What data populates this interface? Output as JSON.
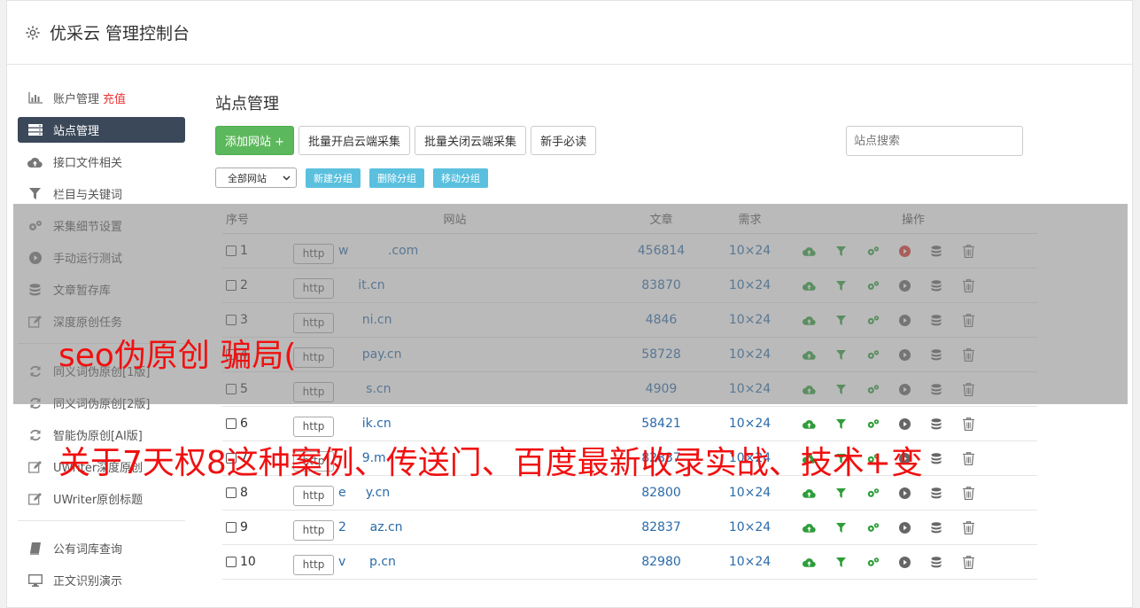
{
  "header": {
    "title": "优采云 管理控制台",
    "icon": "gear-icon"
  },
  "sidebar": {
    "items": [
      {
        "label": "账户管理",
        "extra": "充值",
        "icon": "bar-chart-icon"
      },
      {
        "label": "站点管理",
        "icon": "server-icon",
        "active": true
      },
      {
        "label": "接口文件相关",
        "icon": "cloud-upload-icon"
      },
      {
        "label": "栏目与关键词",
        "icon": "filter-icon"
      },
      {
        "label": "采集细节设置",
        "icon": "cogs-icon"
      },
      {
        "label": "手动运行测试",
        "icon": "play-circle-icon"
      },
      {
        "label": "文章暂存库",
        "icon": "database-icon"
      },
      {
        "label": "深度原创任务",
        "icon": "edit-icon"
      },
      {
        "label": "同义词伪原创[1版]",
        "icon": "refresh-icon"
      },
      {
        "label": "同义词伪原创[2版]",
        "icon": "refresh-icon"
      },
      {
        "label": "智能伪原创[AI版]",
        "icon": "refresh-icon"
      },
      {
        "label": "UWriter深度原创",
        "icon": "edit-icon"
      },
      {
        "label": "UWriter原创标题",
        "icon": "edit-icon"
      },
      {
        "label": "公有词库查询",
        "icon": "book-icon"
      },
      {
        "label": "正文识别演示",
        "icon": "monitor-icon"
      }
    ]
  },
  "main": {
    "title": "站点管理",
    "buttons": {
      "add_site": "添加网站 +",
      "batch_enable": "批量开启云端采集",
      "batch_disable": "批量关闭云端采集",
      "newbie": "新手必读"
    },
    "search_placeholder": "站点搜索",
    "group_select": "全部网站",
    "group_buttons": {
      "new": "新建分组",
      "delete": "删除分组",
      "move": "移动分组"
    },
    "table": {
      "headers": {
        "no": "序号",
        "site": "网站",
        "articles": "文章",
        "demand": "需求",
        "ops": "操作"
      },
      "rows": [
        {
          "no": "1",
          "http": "http",
          "site": "w          .com",
          "articles": "456814",
          "demand": "10×24"
        },
        {
          "no": "2",
          "http": "http",
          "site": "     it.cn",
          "articles": "83870",
          "demand": "10×24"
        },
        {
          "no": "3",
          "http": "http",
          "site": "      ni.cn",
          "articles": "4846",
          "demand": "10×24"
        },
        {
          "no": "4",
          "http": "http",
          "site": "      pay.cn",
          "articles": "58728",
          "demand": "10×24"
        },
        {
          "no": "5",
          "http": "http",
          "site": "       s.cn",
          "articles": "4909",
          "demand": "10×24"
        },
        {
          "no": "6",
          "http": "http",
          "site": "      ik.cn",
          "articles": "58421",
          "demand": "10×24"
        },
        {
          "no": "7",
          "http": "http",
          "site": "      9.m",
          "articles": "82837",
          "demand": "10×24"
        },
        {
          "no": "8",
          "http": "http",
          "site": "e     y.cn",
          "articles": "82800",
          "demand": "10×24"
        },
        {
          "no": "9",
          "http": "http",
          "site": "2      az.cn",
          "articles": "82837",
          "demand": "10×24"
        },
        {
          "no": "10",
          "http": "http",
          "site": "v      p.cn",
          "articles": "82980",
          "demand": "10×24"
        }
      ]
    }
  },
  "overlay": {
    "line1": "seo伪原创 骗局(",
    "line2": "关于7天权8这种案例、传送门、百度最新收录实战、技术+变"
  },
  "colors": {
    "active_nav": "#3b4859",
    "green": "#5cb85c",
    "info": "#5bc0de",
    "link": "#2a6aa8",
    "overlay_text": "#f01010"
  }
}
